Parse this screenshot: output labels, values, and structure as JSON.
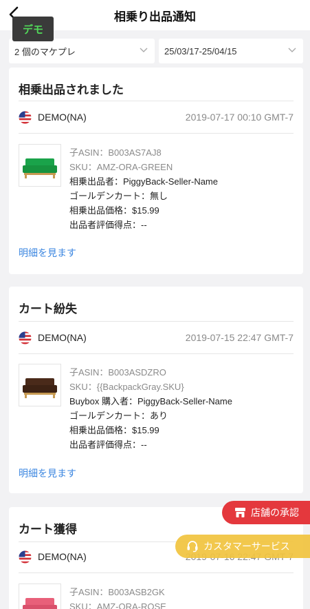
{
  "header": {
    "title": "相乗り出品通知",
    "demo_badge": "デモ"
  },
  "filters": {
    "marketplace": "2 個のマケプレ",
    "date_range": "25/03/17-25/04/15"
  },
  "cards": [
    {
      "title": "相乗出品されました",
      "market": "DEMO(NA)",
      "timestamp": "2019-07-17 00:10 GMT-7",
      "child_asin": "子ASIN：B003AS7AJ8",
      "sku": "SKU：AMZ-ORA-GREEN",
      "seller": "相乗出品者：PiggyBack-Seller-Name",
      "golden_cart": "ゴールデンカート：無し",
      "price": "相乗出品価格：$15.99",
      "rating": "出品者評価得点：--",
      "detail_link": "明細を見ます",
      "thumb_color": "#1aa34a"
    },
    {
      "title": "カート紛失",
      "market": "DEMO(NA)",
      "timestamp": "2019-07-15 22:47 GMT-7",
      "child_asin": "子ASIN：B003ASDZRO",
      "sku": "SKU：{{BackpackGray.SKU}",
      "seller": "Buybox 購入者：PiggyBack-Seller-Name",
      "golden_cart": "ゴールデンカート：あり",
      "price": "相乗出品価格：$15.99",
      "rating": "出品者評価得点：--",
      "detail_link": "明細を見ます",
      "thumb_color": "#4a2a1a"
    },
    {
      "title": "カート獲得",
      "market": "DEMO(NA)",
      "timestamp": "2019-07-16 22:47 GMT-7",
      "child_asin": "子ASIN：B003ASB2GK",
      "sku": "SKU：AMZ-ORA-ROSE",
      "thumb_color": "#e8607a"
    }
  ],
  "fabs": {
    "store_approval": "店舗の承認",
    "customer_service": "カスタマーサービス"
  }
}
